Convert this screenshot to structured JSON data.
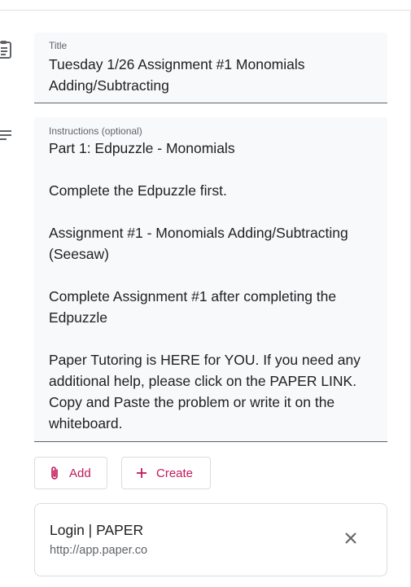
{
  "form": {
    "title_label": "Title",
    "title_lines": [
      "Tuesday 1/26 Assignment #1 Monomials",
      "Adding/Subtracting"
    ],
    "instructions_label": "Instructions (optional)",
    "instructions_lines": [
      "Part 1: Edpuzzle - Monomials",
      "",
      "Complete the Edpuzzle first.",
      "",
      "Assignment #1 - Monomials Adding/Subtracting",
      "(Seesaw)",
      "",
      "Complete Assignment #1 after completing the",
      "Edpuzzle",
      "",
      "Paper Tutoring is HERE for YOU. If you need any",
      "additional help, please click on the PAPER LINK.",
      "Copy and Paste the problem or write it on the",
      "whiteboard."
    ]
  },
  "actions": {
    "add_label": "Add",
    "create_label": "Create"
  },
  "attachment": {
    "title": "Login | PAPER",
    "url": "http://app.paper.co"
  },
  "colors": {
    "accent": "#c2185b",
    "field_bg": "#f8f9fa",
    "muted_text": "#5f6368"
  },
  "icons": {
    "title_side": "clipboard-icon",
    "instructions_side": "notes-lines-icon",
    "add": "paperclip-icon",
    "create": "plus-icon",
    "remove": "close-icon"
  }
}
